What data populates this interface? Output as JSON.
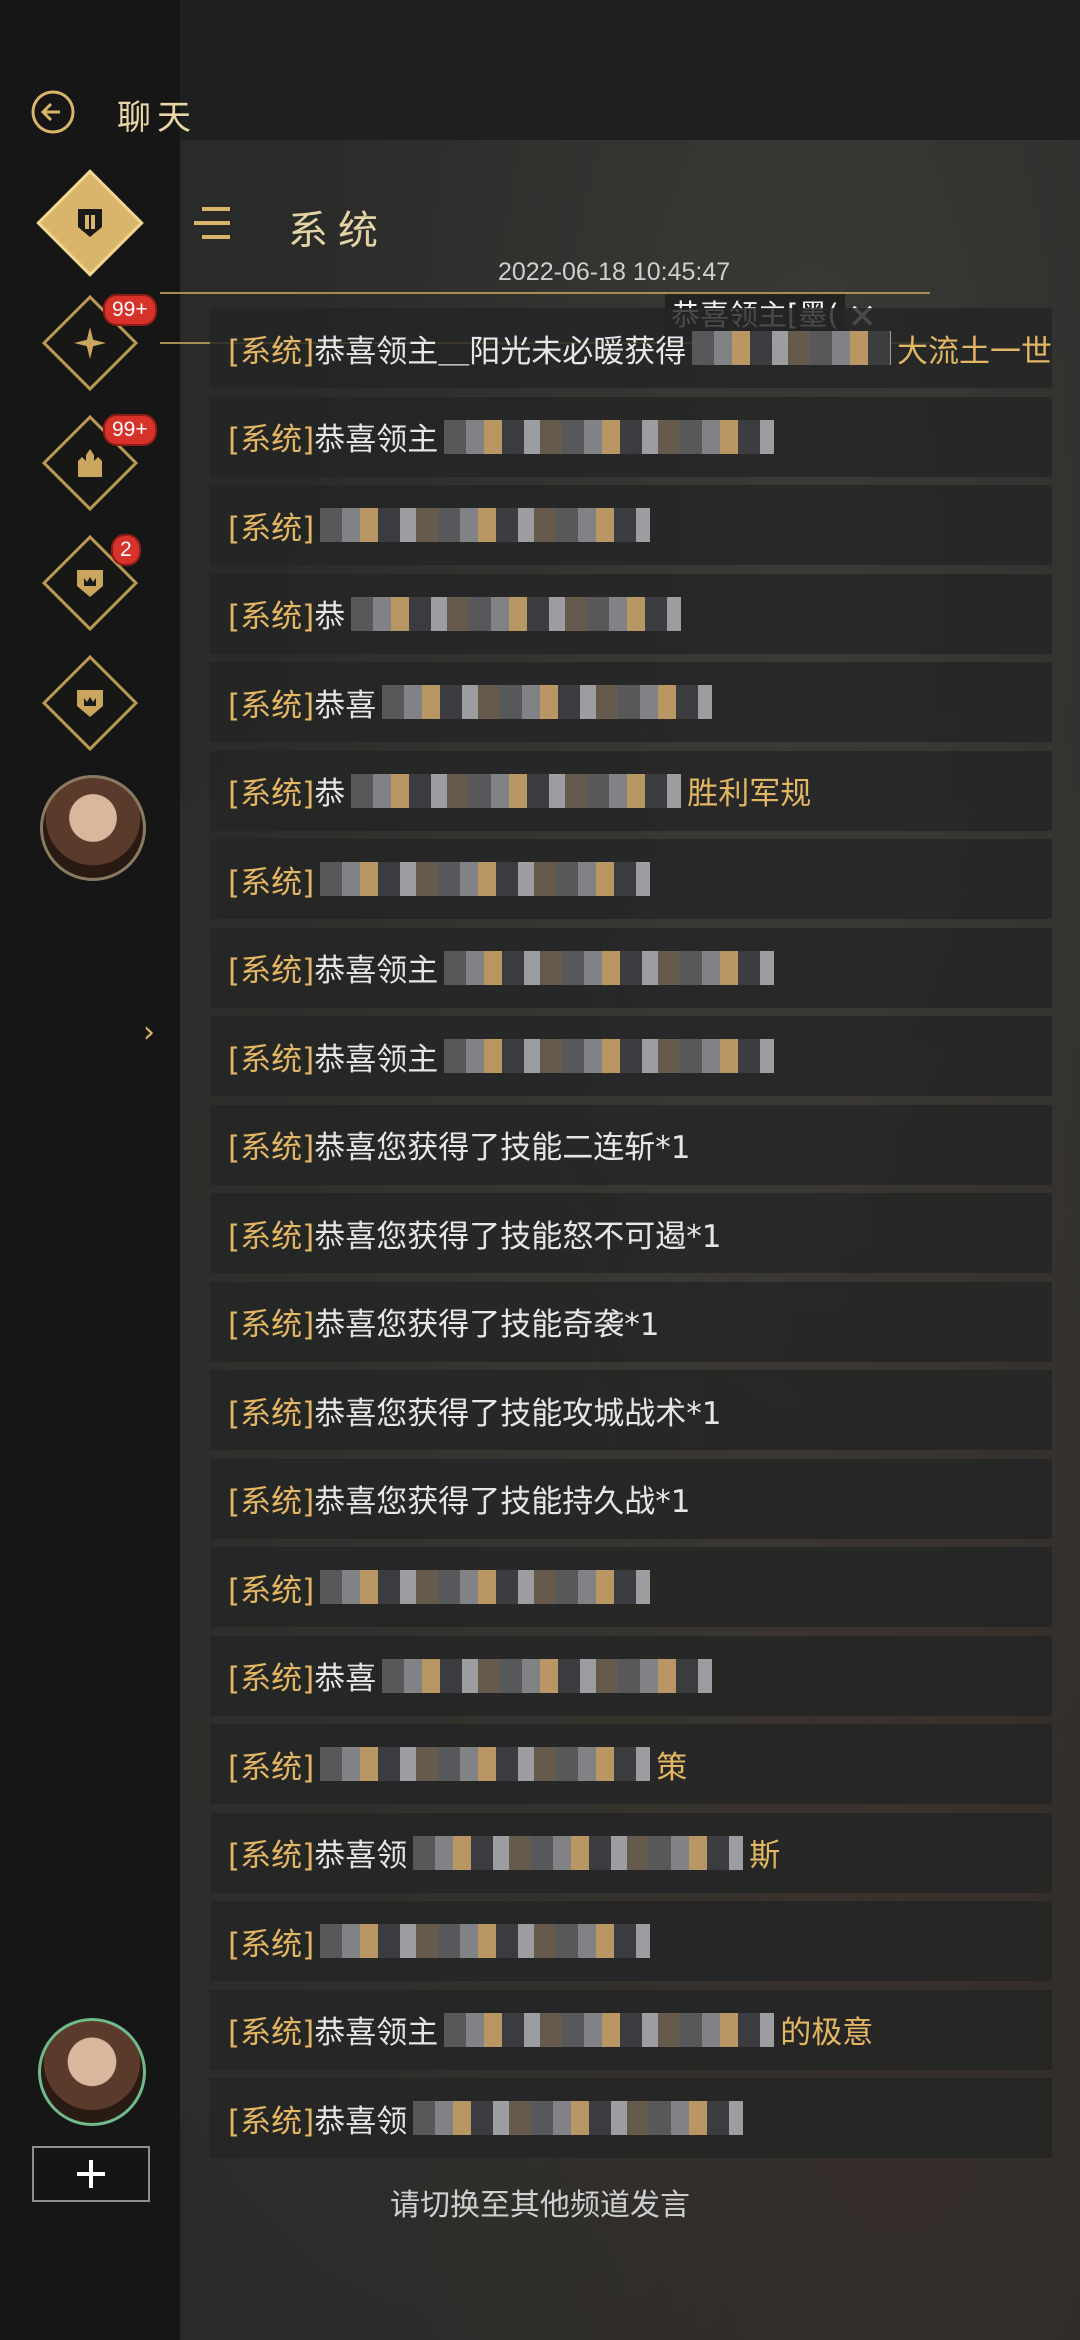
{
  "header": {
    "title": "聊天"
  },
  "channel": {
    "title": "系统",
    "timestamp": "2022-06-18 10:45:47"
  },
  "ticker": {
    "text": "恭喜领主[墨("
  },
  "rail": {
    "badges": [
      "99+",
      "99+",
      "2"
    ]
  },
  "messages": [
    {
      "tag": "[系统]",
      "text": "恭喜领主＿阳光未必暖获得",
      "mosaic": true,
      "suffix": "大流土一世"
    },
    {
      "tag": "[系统]",
      "text": "恭喜领主",
      "mosaic": true,
      "suffix": ""
    },
    {
      "tag": "[系统]",
      "text": "",
      "mosaic": true,
      "suffix": ""
    },
    {
      "tag": "[系统]",
      "text": "恭",
      "mosaic": true,
      "suffix": ""
    },
    {
      "tag": "[系统]",
      "text": "恭喜",
      "mosaic": true,
      "suffix": ""
    },
    {
      "tag": "[系统]",
      "text": "恭",
      "mosaic": true,
      "suffix": "胜利军规"
    },
    {
      "tag": "[系统]",
      "text": "",
      "mosaic": true,
      "suffix": ""
    },
    {
      "tag": "[系统]",
      "text": "恭喜领主",
      "mosaic": true,
      "suffix": ""
    },
    {
      "tag": "[系统]",
      "text": "恭喜领主",
      "mosaic": true,
      "suffix": ""
    },
    {
      "tag": "[系统]",
      "text": "恭喜您获得了技能二连斩*1",
      "mosaic": false,
      "suffix": ""
    },
    {
      "tag": "[系统]",
      "text": "恭喜您获得了技能怒不可遏*1",
      "mosaic": false,
      "suffix": ""
    },
    {
      "tag": "[系统]",
      "text": "恭喜您获得了技能奇袭*1",
      "mosaic": false,
      "suffix": ""
    },
    {
      "tag": "[系统]",
      "text": "恭喜您获得了技能攻城战术*1",
      "mosaic": false,
      "suffix": ""
    },
    {
      "tag": "[系统]",
      "text": "恭喜您获得了技能持久战*1",
      "mosaic": false,
      "suffix": ""
    },
    {
      "tag": "[系统]",
      "text": "",
      "mosaic": true,
      "suffix": ""
    },
    {
      "tag": "[系统]",
      "text": "恭喜",
      "mosaic": true,
      "suffix": ""
    },
    {
      "tag": "[系统]",
      "text": "",
      "mosaic": true,
      "suffix": "策"
    },
    {
      "tag": "[系统]",
      "text": "恭喜领",
      "mosaic": true,
      "suffix": "斯"
    },
    {
      "tag": "[系统]",
      "text": "",
      "mosaic": true,
      "suffix": ""
    },
    {
      "tag": "[系统]",
      "text": "恭喜领主",
      "mosaic": true,
      "suffix": "的极意"
    },
    {
      "tag": "[系统]",
      "text": "恭喜领",
      "mosaic": true,
      "suffix": ""
    }
  ],
  "footer": {
    "hint": "请切换至其他频道发言"
  },
  "colors": {
    "accent_gold": "#e3b664",
    "badge_red": "#d8332b"
  }
}
